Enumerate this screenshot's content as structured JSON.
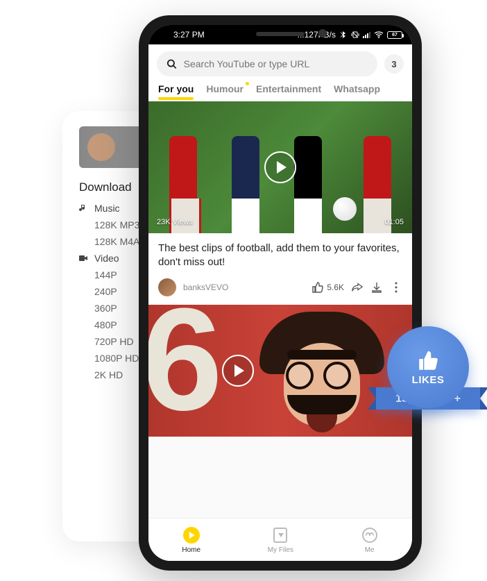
{
  "status": {
    "time": "3:27 PM",
    "net": "...127KB/s",
    "battery": "67"
  },
  "search": {
    "placeholder": "Search YouTube or type URL",
    "count": "3"
  },
  "tabs": [
    {
      "label": "For you",
      "active": true
    },
    {
      "label": "Humour",
      "dot": true
    },
    {
      "label": "Entertainment"
    },
    {
      "label": "Whatsapp"
    }
  ],
  "video1": {
    "views": "23K Views",
    "duration": "01:05",
    "title": "The best clips of football, add them to your favorites, don't miss out!",
    "channel": "banksVEVO",
    "likes": "5.6K"
  },
  "bottom": [
    {
      "label": "Home",
      "active": true
    },
    {
      "label": "My Files"
    },
    {
      "label": "Me"
    }
  ],
  "back_card": {
    "heading": "Download",
    "music_label": "Music",
    "music_items": [
      "128K MP3",
      "128K M4A"
    ],
    "video_label": "Video",
    "video_items": [
      "144P",
      "240P",
      "360P",
      "480P",
      "720P HD",
      "1080P HD",
      "2K HD"
    ]
  },
  "likes_badge": {
    "label": "LIKES",
    "count": "15,000,000 +"
  }
}
